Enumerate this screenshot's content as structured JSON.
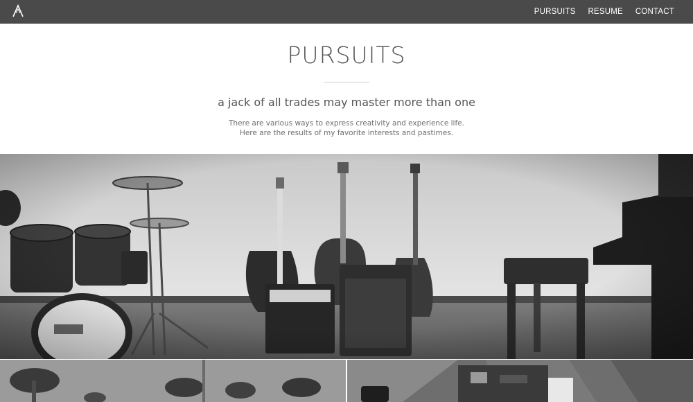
{
  "nav": {
    "logo_name": "a-logo-icon",
    "links": [
      "PURSUITS",
      "RESUME",
      "CONTACT"
    ]
  },
  "header": {
    "title": "PURSUITS",
    "subtitle": "a jack of all trades may master more than one",
    "description_lines": [
      "There are various ways to express creativity and experience life.",
      "Here are the results of my favorite interests and pastimes."
    ]
  },
  "images": {
    "hero": "music-instruments-photo",
    "tile_left": "palm-trees-photo",
    "tile_right": "electronics-photo"
  }
}
